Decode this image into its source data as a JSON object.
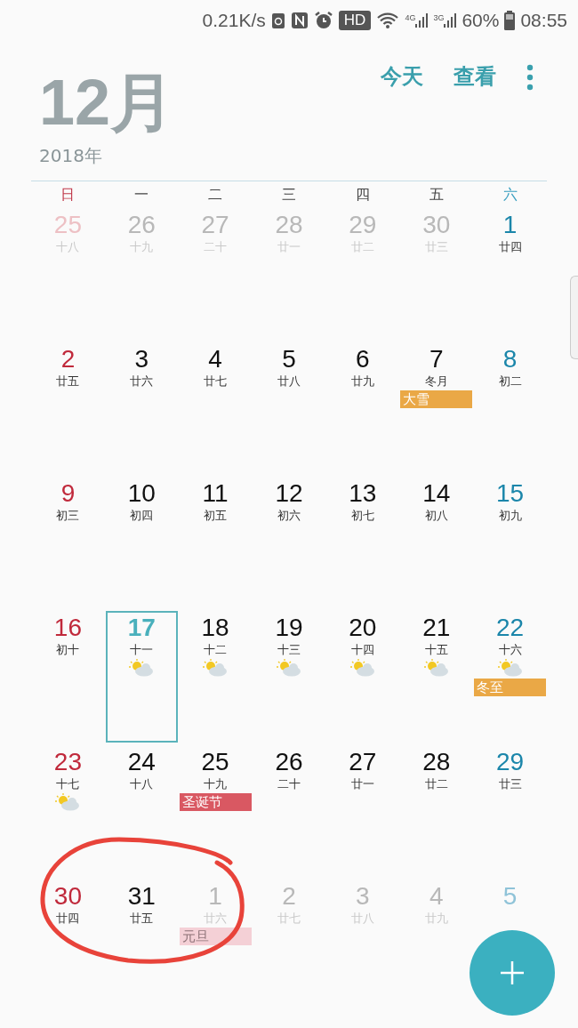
{
  "status_bar": {
    "speed": "0.21K/s",
    "hd": "HD",
    "net1": "4G",
    "net2": "3G",
    "battery": "60%",
    "time": "08:55"
  },
  "header": {
    "month": "12月",
    "year": "2018年",
    "actions": [
      "今天",
      "查看"
    ]
  },
  "weekdays": [
    "日",
    "一",
    "二",
    "三",
    "四",
    "五",
    "六"
  ],
  "days": [
    {
      "number": "25",
      "lunar": "十八",
      "muted": true,
      "selected": false
    },
    {
      "number": "26",
      "lunar": "十九",
      "muted": true,
      "selected": false
    },
    {
      "number": "27",
      "lunar": "二十",
      "muted": true,
      "selected": false
    },
    {
      "number": "28",
      "lunar": "廿一",
      "muted": true,
      "selected": false
    },
    {
      "number": "29",
      "lunar": "廿二",
      "muted": true,
      "selected": false
    },
    {
      "number": "30",
      "lunar": "廿三",
      "muted": true,
      "selected": false
    },
    {
      "number": "1",
      "lunar": "廿四",
      "muted": false,
      "selected": false
    },
    {
      "number": "2",
      "lunar": "廿五",
      "muted": false,
      "selected": false
    },
    {
      "number": "3",
      "lunar": "廿六",
      "muted": false,
      "selected": false
    },
    {
      "number": "4",
      "lunar": "廿七",
      "muted": false,
      "selected": false
    },
    {
      "number": "5",
      "lunar": "廿八",
      "muted": false,
      "selected": false
    },
    {
      "number": "6",
      "lunar": "廿九",
      "muted": false,
      "selected": false
    },
    {
      "number": "7",
      "lunar": "冬月",
      "muted": false,
      "selected": false,
      "event": {
        "label": "大雪",
        "color": "#eaa846"
      }
    },
    {
      "number": "8",
      "lunar": "初二",
      "muted": false,
      "selected": false
    },
    {
      "number": "9",
      "lunar": "初三",
      "muted": false,
      "selected": false
    },
    {
      "number": "10",
      "lunar": "初四",
      "muted": false,
      "selected": false
    },
    {
      "number": "11",
      "lunar": "初五",
      "muted": false,
      "selected": false
    },
    {
      "number": "12",
      "lunar": "初六",
      "muted": false,
      "selected": false
    },
    {
      "number": "13",
      "lunar": "初七",
      "muted": false,
      "selected": false
    },
    {
      "number": "14",
      "lunar": "初八",
      "muted": false,
      "selected": false
    },
    {
      "number": "15",
      "lunar": "初九",
      "muted": false,
      "selected": false
    },
    {
      "number": "16",
      "lunar": "初十",
      "muted": false,
      "selected": false
    },
    {
      "number": "17",
      "lunar": "十一",
      "muted": false,
      "selected": true,
      "weather": true
    },
    {
      "number": "18",
      "lunar": "十二",
      "muted": false,
      "selected": false,
      "weather": true
    },
    {
      "number": "19",
      "lunar": "十三",
      "muted": false,
      "selected": false,
      "weather": true
    },
    {
      "number": "20",
      "lunar": "十四",
      "muted": false,
      "selected": false,
      "weather": true
    },
    {
      "number": "21",
      "lunar": "十五",
      "muted": false,
      "selected": false,
      "weather": true
    },
    {
      "number": "22",
      "lunar": "十六",
      "muted": false,
      "selected": false,
      "weather": true,
      "event": {
        "label": "冬至",
        "color": "#eaa846"
      }
    },
    {
      "number": "23",
      "lunar": "十七",
      "muted": false,
      "selected": false,
      "weather": true
    },
    {
      "number": "24",
      "lunar": "十八",
      "muted": false,
      "selected": false
    },
    {
      "number": "25",
      "lunar": "十九",
      "muted": false,
      "selected": false,
      "event": {
        "label": "圣诞节",
        "color": "#d95862"
      }
    },
    {
      "number": "26",
      "lunar": "二十",
      "muted": false,
      "selected": false
    },
    {
      "number": "27",
      "lunar": "廿一",
      "muted": false,
      "selected": false
    },
    {
      "number": "28",
      "lunar": "廿二",
      "muted": false,
      "selected": false
    },
    {
      "number": "29",
      "lunar": "廿三",
      "muted": false,
      "selected": false
    },
    {
      "number": "30",
      "lunar": "廿四",
      "muted": false,
      "selected": false
    },
    {
      "number": "31",
      "lunar": "廿五",
      "muted": false,
      "selected": false
    },
    {
      "number": "1",
      "lunar": "廿六",
      "muted": true,
      "selected": false,
      "event": {
        "label": "元旦",
        "color": "#f4d0d6"
      }
    },
    {
      "number": "2",
      "lunar": "廿七",
      "muted": true,
      "selected": false
    },
    {
      "number": "3",
      "lunar": "廿八",
      "muted": true,
      "selected": false
    },
    {
      "number": "4",
      "lunar": "廿九",
      "muted": true,
      "selected": false
    },
    {
      "number": "5",
      "muted": true,
      "selected": false
    }
  ]
}
